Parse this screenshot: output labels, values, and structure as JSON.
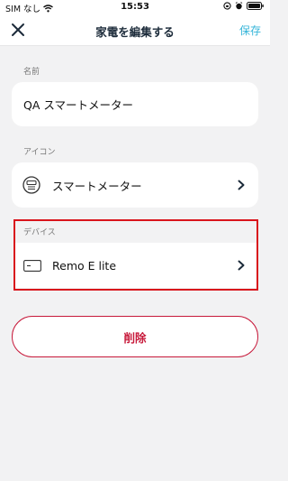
{
  "status_bar": {
    "carrier": "SIM なし",
    "time": "15:53"
  },
  "nav": {
    "title": "家電を編集する",
    "save_label": "保存"
  },
  "name_section": {
    "label": "名前",
    "value": "QA スマートメーター"
  },
  "icon_section": {
    "label": "アイコン",
    "value": "スマートメーター",
    "icon": "smart-meter-icon"
  },
  "device_section": {
    "label": "デバイス",
    "value": "Remo E lite",
    "icon": "device-card-icon"
  },
  "delete_label": "削除",
  "colors": {
    "accent": "#35b5d9",
    "danger": "#c7193a",
    "highlight": "#d9141c"
  }
}
